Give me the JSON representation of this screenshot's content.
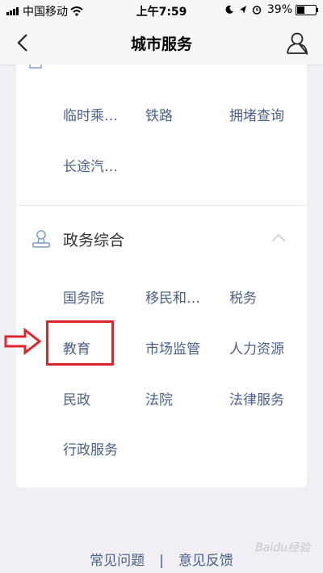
{
  "status_bar": {
    "carrier": "中国移动",
    "time": "上午7:59",
    "battery": "39%"
  },
  "nav": {
    "title": "城市服务"
  },
  "transport_items": [
    "临时乘…",
    "铁路",
    "拥堵查询",
    "长途汽…"
  ],
  "section": {
    "title": "政务综合",
    "items": [
      "国务院",
      "移民和…",
      "税务",
      "教育",
      "市场监管",
      "人力资源",
      "民政",
      "法院",
      "法律服务",
      "行政服务"
    ]
  },
  "footer": {
    "faq": "常见问题",
    "separator": "|",
    "feedback": "意见反馈"
  },
  "watermark": "Baidu经验",
  "colors": {
    "link": "#4b5f88",
    "highlight": "#e0242c",
    "background": "#efeff4"
  }
}
